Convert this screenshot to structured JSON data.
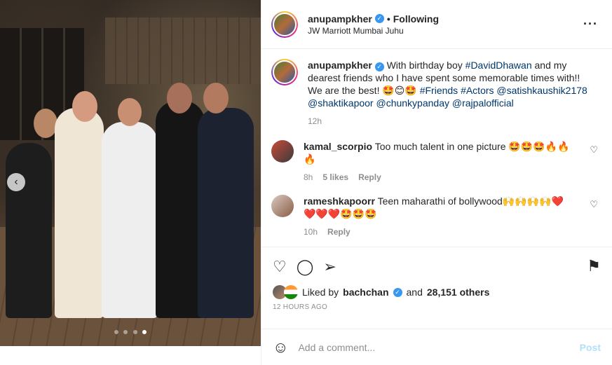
{
  "post": {
    "username": "anupampkher",
    "following_label": "Following",
    "location": "JW Marriott Mumbai Juhu",
    "more_icon": "more-options-icon"
  },
  "caption": {
    "username": "anupampkher",
    "text": "With birthday boy",
    "tag1": "#DavidDhawan",
    "text2": "and my dearest friends who I have spent some memorable times with!! We are the best! 🤩😊🤩",
    "tag2": "#Friends",
    "tag3": "#Actors",
    "tag4": "@satishkaushik2178",
    "tag5": "@shaktikapoor",
    "tag6": "@chunkypanday",
    "tag7": "@rajpalofficial",
    "time": "12h"
  },
  "comments": [
    {
      "username": "kamal_scorpio",
      "text": "Too much talent in one picture 🤩🤩🤩🔥🔥🔥",
      "time": "8h",
      "likes": "5 likes",
      "reply": "Reply"
    },
    {
      "username": "rameshkapoorr",
      "text": "Teen maharathi of bollywood🙌🙌🙌🙌❤️ ❤️❤️❤️🤩🤩🤩",
      "time": "10h",
      "reply": "Reply"
    }
  ],
  "likes": {
    "prefix": "Liked by",
    "user": "bachchan",
    "and": "and",
    "count": "28,151 others"
  },
  "timestamp": "12 HOURS AGO",
  "add_comment": {
    "placeholder": "Add a comment...",
    "post_label": "Post"
  },
  "carousel": {
    "total": 4,
    "active": 4
  }
}
